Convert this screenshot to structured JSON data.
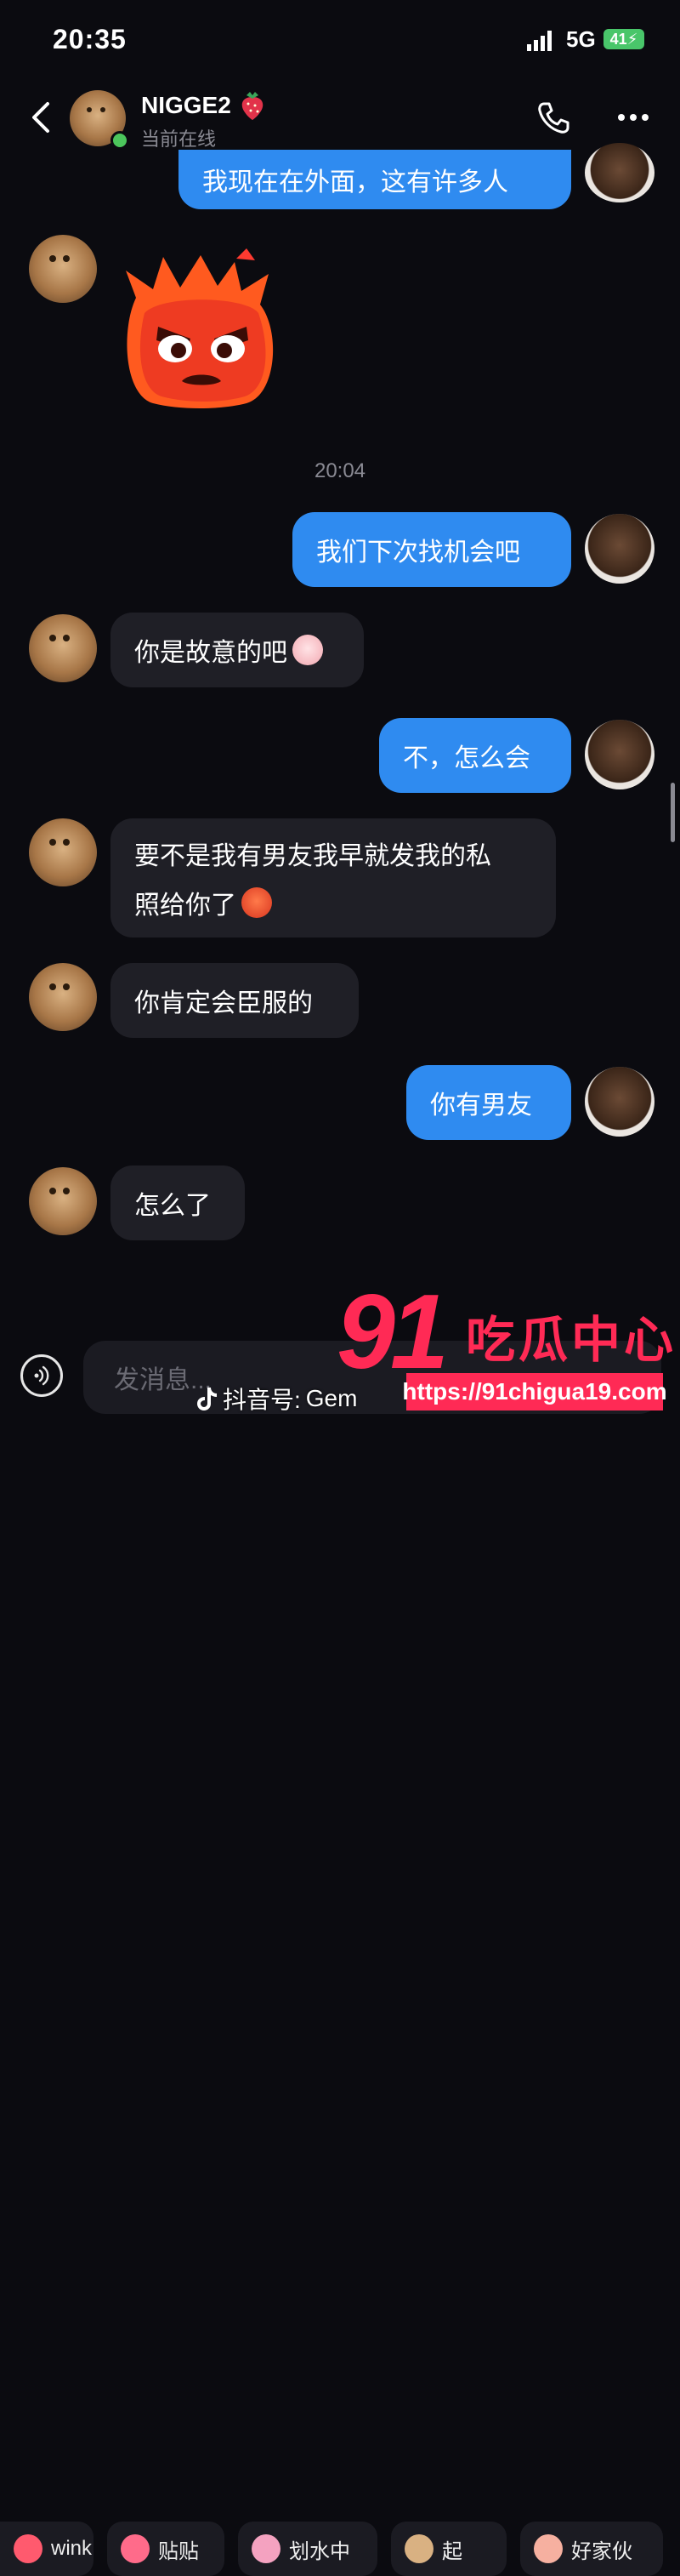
{
  "status_bar": {
    "time": "20:35",
    "network": "5G",
    "battery": "41"
  },
  "header": {
    "contact_name": "NIGGE2",
    "status": "当前在线"
  },
  "chat": {
    "partial_out": "我现在在外面，这有许多人",
    "timestamp": "20:04",
    "messages": [
      {
        "dir": "out",
        "text": "我们下次找机会吧"
      },
      {
        "dir": "in",
        "text": "你是故意的吧"
      },
      {
        "dir": "out",
        "text": "不，怎么会"
      },
      {
        "dir": "in",
        "line1": "要不是我有男友我早就发我的私",
        "line2": "照给你了"
      },
      {
        "dir": "in",
        "text": "你肯定会臣服的"
      },
      {
        "dir": "out",
        "text": "你有男友"
      },
      {
        "dir": "in",
        "text": "怎么了"
      }
    ]
  },
  "quick_stickers": [
    "wink",
    "贴贴",
    "划水中",
    "起",
    "好家伙"
  ],
  "input": {
    "placeholder": "发消息..."
  },
  "watermark": {
    "douyin_label": "抖音号:",
    "douyin_id": "Gem",
    "logo_number": "91",
    "logo_text": "吃瓜中心",
    "url": "https://91chigua19.com"
  }
}
